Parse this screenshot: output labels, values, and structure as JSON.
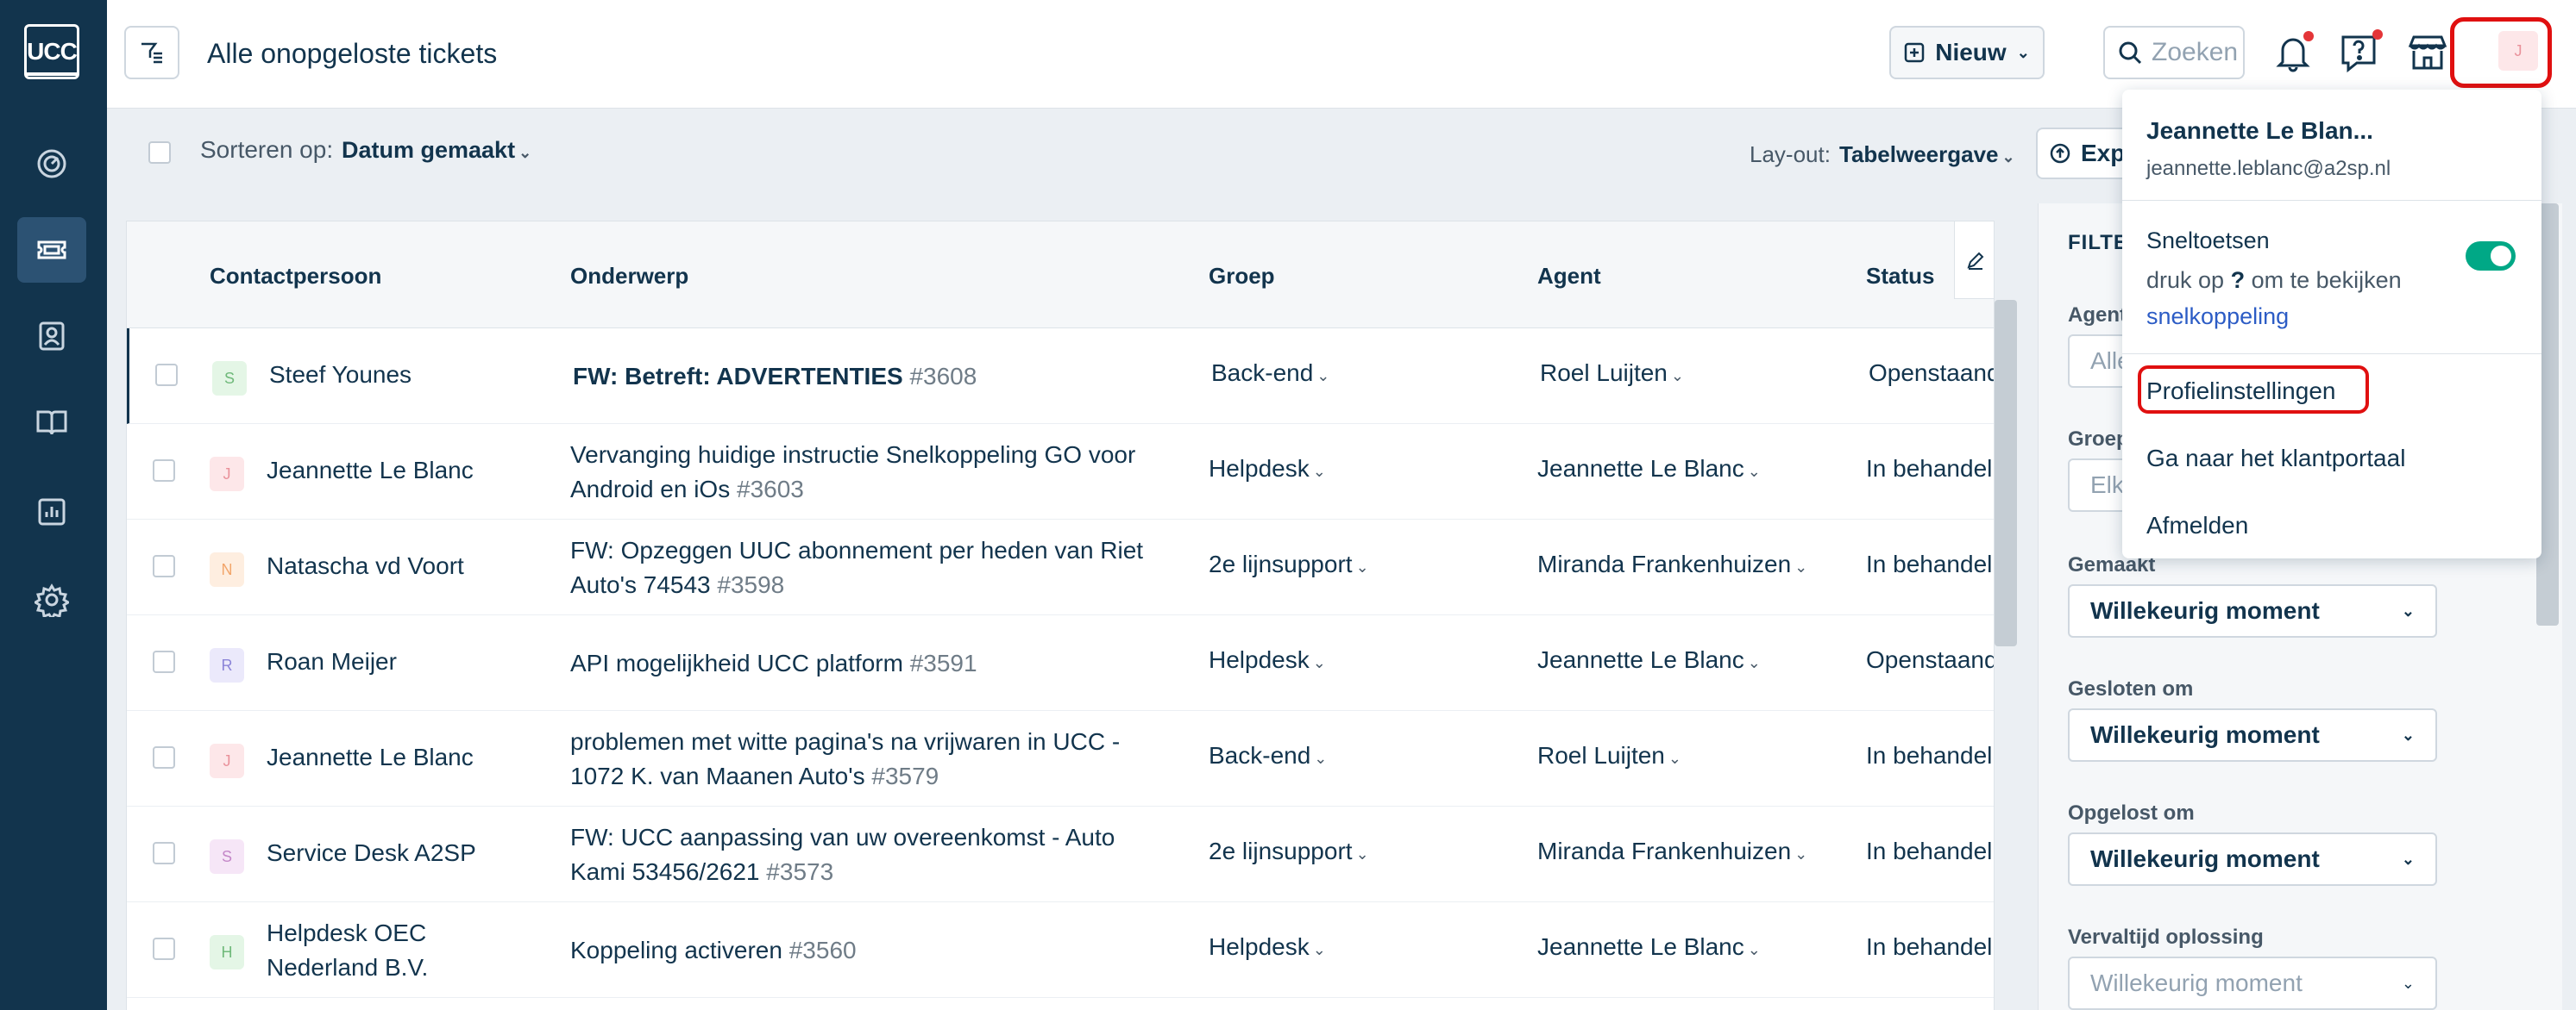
{
  "app": {
    "logo_text": "UCC"
  },
  "header": {
    "title": "Alle onopgeloste tickets",
    "new_button": "Nieuw",
    "search_placeholder": "Zoeken",
    "avatar_initial": "J"
  },
  "subbar": {
    "sort_label": "Sorteren op:",
    "sort_value": "Datum gemaakt",
    "layout_label": "Lay-out:",
    "layout_value": "Tabelweergave",
    "export_label": "Exp"
  },
  "table": {
    "columns": [
      "Contactpersoon",
      "Onderwerp",
      "Groep",
      "Agent",
      "Status"
    ],
    "rows": [
      {
        "initial": "S",
        "contact": "Steef Younes",
        "subject": "FW: Betreft: ADVERTENTIES",
        "number": "#3608",
        "group": "Back-end",
        "agent": "Roel Luijten",
        "status": "Openstaand"
      },
      {
        "initial": "J",
        "contact": "Jeannette Le Blanc",
        "subject": "Vervanging huidige instructie Snelkoppeling GO voor Android en iOs",
        "number": "#3603",
        "group": "Helpdesk",
        "agent": "Jeannette Le Blanc",
        "status": "In behandel"
      },
      {
        "initial": "N",
        "contact": "Natascha vd Voort",
        "subject": "FW: Opzeggen UUC abonnement per heden van Riet Auto's 74543",
        "number": "#3598",
        "group": "2e lijnsupport",
        "agent": "Miranda Frankenhuizen",
        "status": "In behandel"
      },
      {
        "initial": "R",
        "contact": "Roan Meijer",
        "subject": "API mogelijkheid UCC platform",
        "number": "#3591",
        "group": "Helpdesk",
        "agent": "Jeannette Le Blanc",
        "status": "Openstaand"
      },
      {
        "initial": "J",
        "contact": "Jeannette Le Blanc",
        "subject": "problemen met witte pagina's na vrijwaren in UCC - 1072 K. van Maanen Auto's",
        "number": "#3579",
        "group": "Back-end",
        "agent": "Roel Luijten",
        "status": "In behandel"
      },
      {
        "initial": "S",
        "contact": "Service Desk A2SP",
        "subject": "FW: UCC aanpassing van uw overeenkomst - Auto Kami 53456/2621",
        "number": "#3573",
        "group": "2e lijnsupport",
        "agent": "Miranda Frankenhuizen",
        "status": "In behandel"
      },
      {
        "initial": "H",
        "contact": "Helpdesk OEC Nederland B.V.",
        "subject": "Koppeling activeren",
        "number": "#3560",
        "group": "Helpdesk",
        "agent": "Jeannette Le Blanc",
        "status": "In behandel"
      }
    ]
  },
  "filters": {
    "title": "FILTER",
    "agent_label": "Agent",
    "agent_placeholder": "Alle",
    "group_label": "Groep",
    "group_placeholder": "Elk",
    "created_label": "Gemaakt",
    "created_value": "Willekeurig moment",
    "closed_label": "Gesloten om",
    "closed_value": "Willekeurig moment",
    "resolved_label": "Opgelost om",
    "resolved_value": "Willekeurig moment",
    "due_label": "Vervaltijd oplossing",
    "due_value": "Willekeurig moment"
  },
  "profile_menu": {
    "name": "Jeannette Le Blan...",
    "email": "jeannette.leblanc@a2sp.nl",
    "shortcuts_title": "Sneltoetsen",
    "shortcuts_desc_pre": "druk op",
    "shortcuts_key": "?",
    "shortcuts_desc_post": "om te bekijken",
    "shortcuts_link": "snelkoppeling",
    "profile_settings": "Profielinstellingen",
    "customer_portal": "Ga naar het klantportaal",
    "logout": "Afmelden"
  },
  "colors": {
    "sidebar": "#12344d",
    "annotation": "#e01010",
    "toggle_on": "#00a886",
    "link": "#2c5cc5"
  },
  "avatar_colors": {
    "S": {
      "bg": "#e4f6e6",
      "fg": "#6fb97a"
    },
    "J": {
      "bg": "#fde7e9",
      "fg": "#e9919a"
    },
    "N": {
      "bg": "#feeee0",
      "fg": "#f2a56a"
    },
    "R": {
      "bg": "#ebe9fb",
      "fg": "#8b84d8"
    },
    "Sv": {
      "bg": "#f6e6f7",
      "fg": "#c487c8"
    },
    "H": {
      "bg": "#e4f6e6",
      "fg": "#6fb97a"
    }
  }
}
